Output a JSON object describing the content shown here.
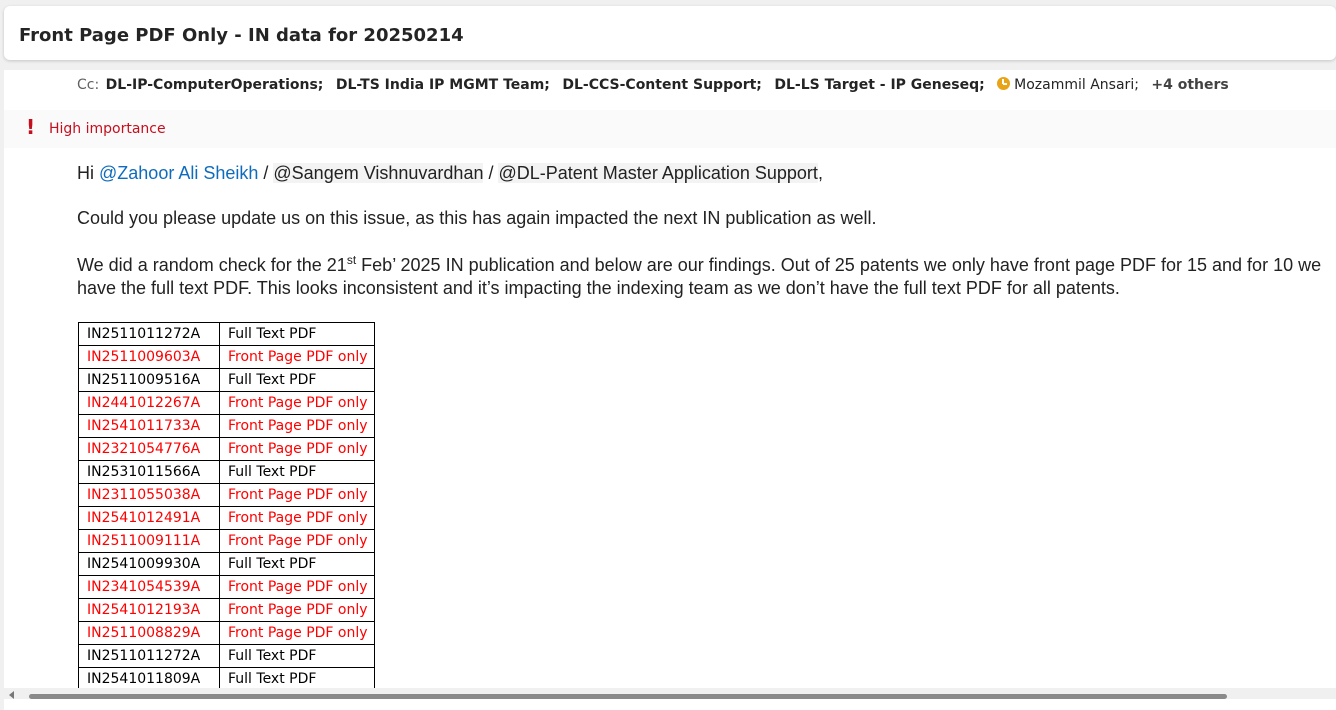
{
  "subject": "Front Page PDF Only - IN data for 20250214",
  "cc": {
    "label": "Cc:",
    "recipients": [
      "DL-IP-ComputerOperations;",
      "DL-TS India IP MGMT Team;",
      "DL-CCS-Content Support;",
      "DL-LS Target - IP Geneseq;"
    ],
    "person": "Mozammil Ansari;",
    "more": "+4 others",
    "status_icon": "away-clock-icon",
    "status_color": "#e8a317"
  },
  "importance": {
    "icon": "exclamation-icon",
    "text": "High importance",
    "color": "#c50f1f"
  },
  "body": {
    "greeting": "Hi",
    "mention1": "@Zahoor Ali Sheikh",
    "slash1": " / ",
    "mention2": "@Sangem Vishnuvardhan",
    "slash2": " / ",
    "mention3": "@DL-Patent Master Application Support",
    "greeting_end": ",",
    "para1": "Could you please update us on this issue, as this has again impacted the next IN publication as well.",
    "para2_start": "We did a random check for the 21",
    "para2_sup": "st",
    "para2_rest": " Feb’ 2025 IN publication and below are our findings. Out of 25 patents we only have front page PDF for 15 and for 10 we have the full text PDF. This looks inconsistent and it’s impacting the indexing team as we don’t have the full text PDF for all patents."
  },
  "table": {
    "rows": [
      {
        "id": "IN2511011272A",
        "status": "Full Text PDF",
        "highlight": false
      },
      {
        "id": "IN2511009603A",
        "status": "Front Page PDF only",
        "highlight": true
      },
      {
        "id": "IN2511009516A",
        "status": "Full Text PDF",
        "highlight": false
      },
      {
        "id": "IN2441012267A",
        "status": "Front Page PDF only",
        "highlight": true
      },
      {
        "id": "IN2541011733A",
        "status": "Front Page PDF only",
        "highlight": true
      },
      {
        "id": "IN2321054776A",
        "status": "Front Page PDF only",
        "highlight": true
      },
      {
        "id": "IN2531011566A",
        "status": "Full Text PDF",
        "highlight": false
      },
      {
        "id": "IN2311055038A",
        "status": "Front Page PDF only",
        "highlight": true
      },
      {
        "id": "IN2541012491A",
        "status": "Front Page PDF only",
        "highlight": true
      },
      {
        "id": "IN2511009111A",
        "status": "Front Page PDF only",
        "highlight": true
      },
      {
        "id": "IN2541009930A",
        "status": "Full Text PDF",
        "highlight": false
      },
      {
        "id": "IN2341054539A",
        "status": "Front Page PDF only",
        "highlight": true
      },
      {
        "id": "IN2541012193A",
        "status": "Front Page PDF only",
        "highlight": true
      },
      {
        "id": "IN2511008829A",
        "status": "Front Page PDF only",
        "highlight": true
      },
      {
        "id": "IN2511011272A",
        "status": "Full Text PDF",
        "highlight": false
      },
      {
        "id": "IN2541011809A",
        "status": "Full Text PDF",
        "highlight": false
      }
    ],
    "highlight_color": "#ff0000"
  }
}
